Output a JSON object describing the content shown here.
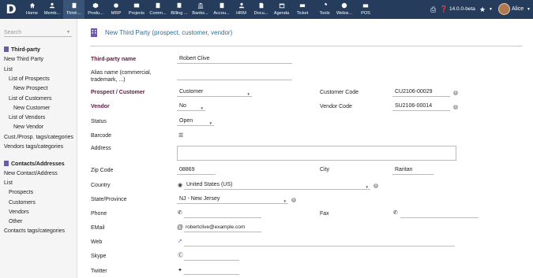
{
  "topbar": {
    "logo": "D",
    "menus": [
      {
        "label": "Home",
        "icon": "home-icon"
      },
      {
        "label": "Memb...",
        "icon": "members-icon"
      },
      {
        "label": "Third-...",
        "icon": "third-party-icon"
      },
      {
        "label": "Produ...",
        "icon": "products-icon"
      },
      {
        "label": "MRP",
        "icon": "mrp-icon"
      },
      {
        "label": "Projects",
        "icon": "projects-icon"
      },
      {
        "label": "Comm...",
        "icon": "commercial-icon"
      },
      {
        "label": "Billing ...",
        "icon": "billing-icon"
      },
      {
        "label": "Banks...",
        "icon": "banks-icon"
      },
      {
        "label": "Accou...",
        "icon": "accounting-icon"
      },
      {
        "label": "HRM",
        "icon": "hrm-icon"
      },
      {
        "label": "Docu...",
        "icon": "documents-icon"
      },
      {
        "label": "Agenda",
        "icon": "agenda-icon"
      },
      {
        "label": "Ticket",
        "icon": "ticket-icon"
      },
      {
        "label": "Tools",
        "icon": "tools-icon"
      },
      {
        "label": "Websi...",
        "icon": "website-icon"
      },
      {
        "label": "POS",
        "icon": "pos-icon"
      }
    ],
    "version": "14.0.0-beta",
    "user": "Alice"
  },
  "sidebar": {
    "search_placeholder": "Search",
    "thirdparty": {
      "title": "Third-party",
      "items": [
        "New Third Party",
        "List",
        "List of Prospects",
        "New Prospect",
        "List of Customers",
        "New Customer",
        "List of Vendors",
        "New Vendor",
        "Cust./Prosp. tags/categories",
        "Vendors tags/categories"
      ]
    },
    "contacts": {
      "title": "Contacts/Addresses",
      "items": [
        "New Contact/Address",
        "List",
        "Prospects",
        "Customers",
        "Vendors",
        "Other",
        "Contacts tags/categories"
      ]
    }
  },
  "page": {
    "title": "New Third Party (prospect, customer, vendor)"
  },
  "form": {
    "name_label": "Third-party name",
    "name_value": "Robert Clive",
    "alias_label": "Alias name (commercial, trademark, ...)",
    "prospect_label": "Prospect / Customer",
    "prospect_value": "Customer",
    "customer_code_label": "Customer Code",
    "customer_code_value": "CU2106-00029",
    "vendor_label": "Vendor",
    "vendor_value": "No",
    "vendor_code_label": "Vendor Code",
    "vendor_code_value": "SU2106-00014",
    "status_label": "Status",
    "status_value": "Open",
    "barcode_label": "Barcode",
    "address_label": "Address",
    "zip_label": "Zip Code",
    "zip_value": "08869",
    "city_label": "City",
    "city_value": "Raritan",
    "country_label": "Country",
    "country_value": "United States (US)",
    "state_label": "State/Province",
    "state_value": "NJ - New Jersey",
    "phone_label": "Phone",
    "fax_label": "Fax",
    "email_label": "EMail",
    "email_value": "robertclive@example.com",
    "web_label": "Web",
    "skype_label": "Skype",
    "twitter_label": "Twitter"
  }
}
